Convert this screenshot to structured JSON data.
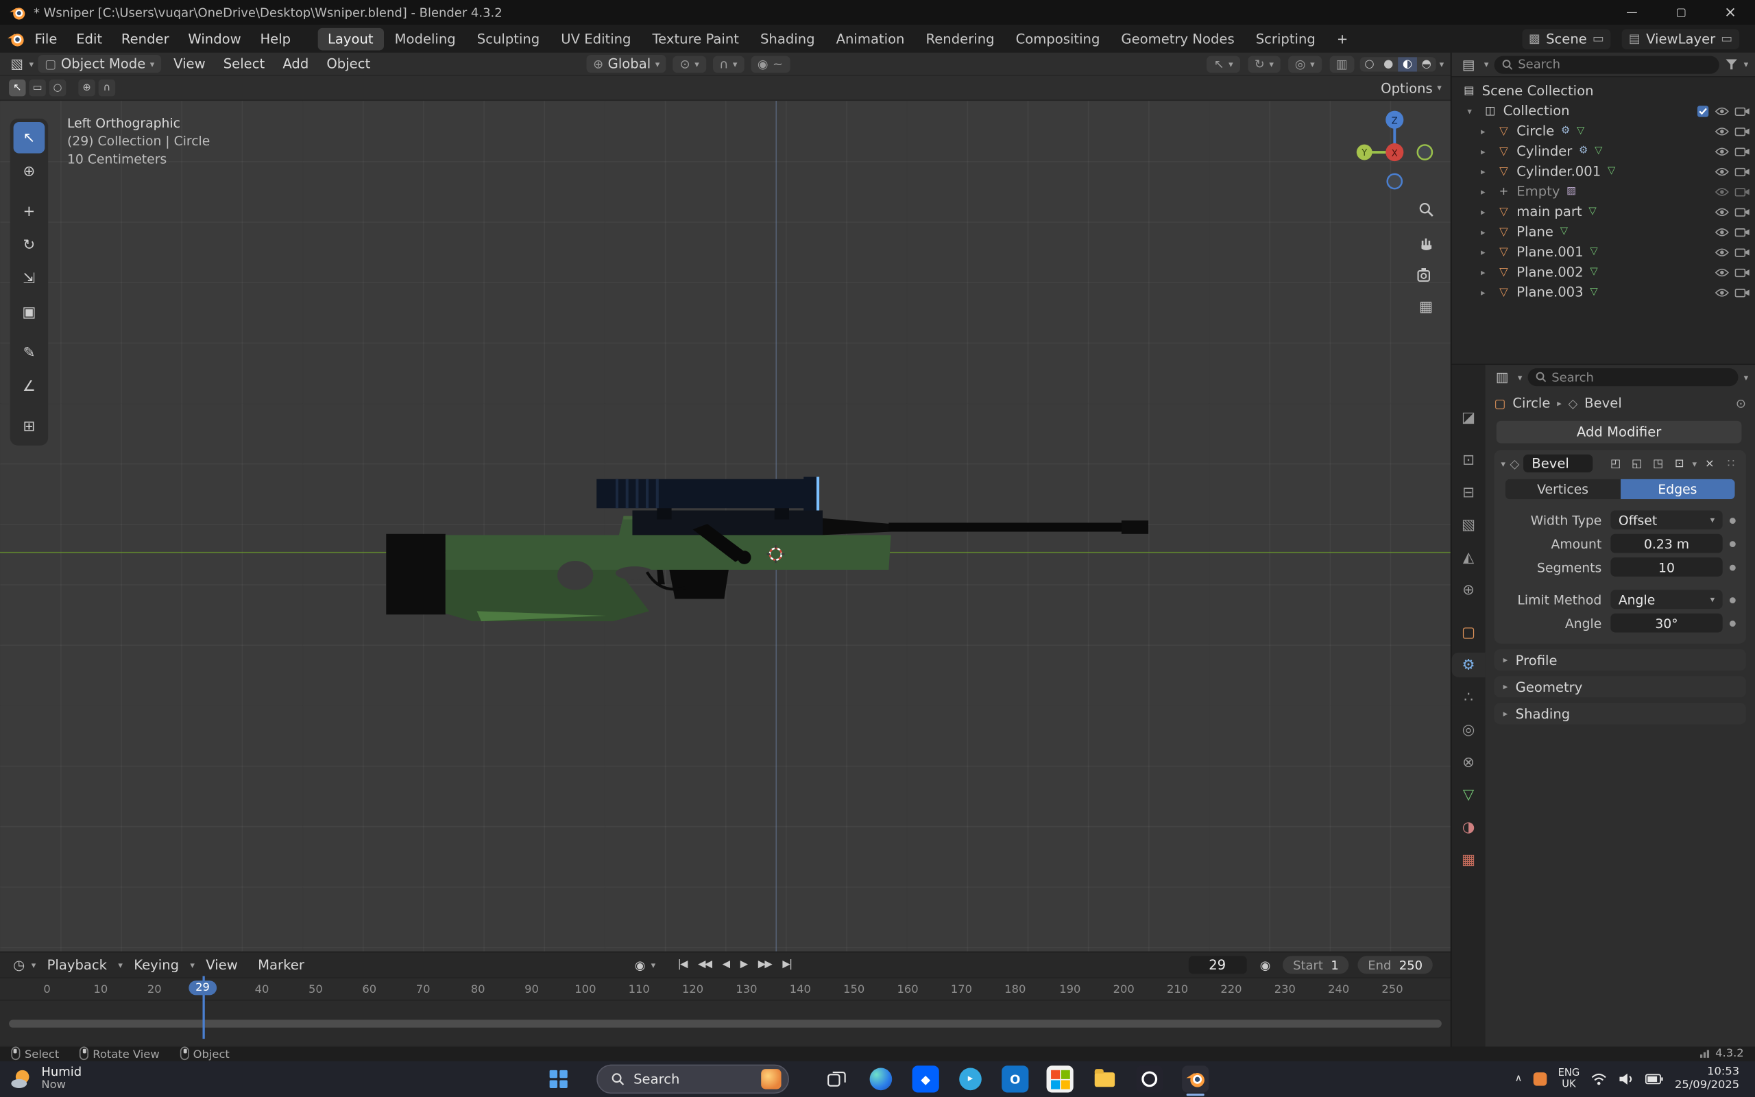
{
  "window": {
    "title": "* Wsniper [C:\\Users\\vuqar\\OneDrive\\Desktop\\Wsniper.blend] - Blender 4.3.2"
  },
  "topbar": {
    "menus": [
      "File",
      "Edit",
      "Render",
      "Window",
      "Help"
    ],
    "workspaces": [
      "Layout",
      "Modeling",
      "Sculpting",
      "UV Editing",
      "Texture Paint",
      "Shading",
      "Animation",
      "Rendering",
      "Compositing",
      "Geometry Nodes",
      "Scripting"
    ],
    "scene": "Scene",
    "viewlayer": "ViewLayer"
  },
  "viewport": {
    "mode": "Object Mode",
    "menus": [
      "View",
      "Select",
      "Add",
      "Object"
    ],
    "orientation": "Global",
    "options_label": "Options",
    "overlay": {
      "line1": "Left Orthographic",
      "line2": "(29) Collection | Circle",
      "line3": "10 Centimeters"
    },
    "gizmo": {
      "x": "X",
      "y": "Y",
      "z": "Z"
    }
  },
  "outliner": {
    "search_placeholder": "Search",
    "scene_collection": "Scene Collection",
    "collection": "Collection",
    "items": [
      {
        "name": "Circle"
      },
      {
        "name": "Cylinder"
      },
      {
        "name": "Cylinder.001"
      },
      {
        "name": "Empty"
      },
      {
        "name": "main part"
      },
      {
        "name": "Plane"
      },
      {
        "name": "Plane.001"
      },
      {
        "name": "Plane.002"
      },
      {
        "name": "Plane.003"
      }
    ]
  },
  "properties": {
    "search_placeholder": "Search",
    "breadcrumb_object": "Circle",
    "breadcrumb_modifier": "Bevel",
    "add_modifier": "Add Modifier",
    "modifier": {
      "name": "Bevel",
      "tab_vertices": "Vertices",
      "tab_edges": "Edges",
      "width_type_label": "Width Type",
      "width_type": "Offset",
      "amount_label": "Amount",
      "amount": "0.23 m",
      "segments_label": "Segments",
      "segments": "10",
      "limit_label": "Limit Method",
      "limit": "Angle",
      "angle_label": "Angle",
      "angle": "30°",
      "sections": [
        "Profile",
        "Geometry",
        "Shading"
      ]
    }
  },
  "timeline": {
    "menus": [
      "Playback",
      "Keying",
      "View",
      "Marker"
    ],
    "current_frame": "29",
    "frame_field": "29",
    "start_label": "Start",
    "start_value": "1",
    "end_label": "End",
    "end_value": "250",
    "ticks": [
      "0",
      "10",
      "20",
      "40",
      "50",
      "60",
      "70",
      "80",
      "90",
      "100",
      "110",
      "120",
      "130",
      "140",
      "150",
      "160",
      "170",
      "180",
      "190",
      "200",
      "210",
      "220",
      "230",
      "240",
      "250"
    ]
  },
  "statusbar": {
    "hint_select": "Select",
    "hint_rotate": "Rotate View",
    "hint_object": "Object",
    "version": "4.3.2"
  },
  "taskbar": {
    "weather_line1": "Humid",
    "weather_line2": "Now",
    "search_label": "Search",
    "tray_lang_top": "ENG",
    "tray_lang_bottom": "UK",
    "time": "10:53",
    "date": "25/09/2025"
  },
  "icons": {
    "chevron": "▾",
    "disclosure": "▸",
    "expanded": "▾",
    "close": "×",
    "minimize": "—",
    "maximize": "▢",
    "editor_3d": "▧",
    "editor_outliner": "▤",
    "editor_props": "▥",
    "editor_timeline": "◷",
    "object_mode": "▢",
    "global": "⊕",
    "pivot": "⊙",
    "magnet": "∩",
    "proportional": "◉",
    "falloff": "~",
    "pointer": "↖",
    "gizmo_tool": "↻",
    "overlays": "◎",
    "xray": "▥",
    "shade_wire": "○",
    "shade_solid": "●",
    "shade_material": "◐",
    "shade_rendered": "◓",
    "grid": "▦",
    "plus": "+",
    "scene": "▩",
    "viewlayer": "▤",
    "new": "▭",
    "collection": "◫",
    "scene_collection": "▤",
    "mesh": "▽",
    "empty": "+",
    "image": "▨",
    "wrench": "⚙",
    "data": "▽",
    "tool_tab": "◪",
    "render_tab": "⊡",
    "output_tab": "⊟",
    "viewlayer_tab": "▧",
    "scene_tab": "◭",
    "world_tab": "⊕",
    "object_tab": "▢",
    "modifier_tab": "⚙",
    "particles_tab": "∴",
    "physics_tab": "◎",
    "constraints_tab": "⊗",
    "data_tab": "▽",
    "material_tab": "◑",
    "texture_tab": "▦",
    "bevel": "◇",
    "pin": "⊙",
    "drag": "∷",
    "toggle_a": "◰",
    "toggle_b": "◱",
    "toggle_c": "◳",
    "toggle_d": "⊡",
    "dot": "●",
    "jump_start": "|◀",
    "prev_key": "◀◀",
    "play_rev": "◀",
    "play": "▶",
    "next_key": "▶▶",
    "jump_end": "▶|",
    "autokey": "◉",
    "tray_chevron": "∧",
    "tool_select": "↖",
    "tool_cursor": "⊕",
    "tool_move": "+",
    "tool_rotate": "↻",
    "tool_scale": "⇲",
    "tool_transform": "▣",
    "tool_annotate": "✎",
    "tool_measure": "∠",
    "tool_cube": "⊞"
  }
}
